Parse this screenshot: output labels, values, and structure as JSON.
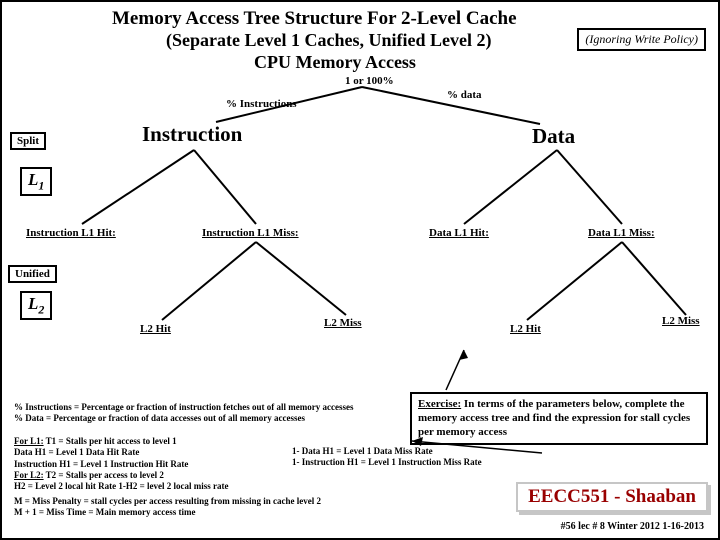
{
  "title": "Memory Access Tree Structure For 2-Level Cache",
  "subtitle": "(Separate Level 1 Caches, Unified Level 2)",
  "ignoring": "(Ignoring Write Policy)",
  "cpu": "CPU Memory  Access",
  "top_pct": "1 or 100%",
  "pct_inst": "% Instructions",
  "pct_data": "% data",
  "split": "Split",
  "inst": "Instruction",
  "data": "Data",
  "l1": "L",
  "l1_sub": "1",
  "il1_hit": "Instruction L1 Hit:",
  "il1_miss": "Instruction L1 Miss:",
  "dl1_hit": "Data L1 Hit:",
  "dl1_miss": "Data L1 Miss:",
  "unified": "Unified",
  "l2": "L",
  "l2_sub": "2",
  "l2_hit": "L2 Hit",
  "l2_miss": "L2  Miss",
  "note1a": "% Instructions = Percentage or fraction of instruction fetches out of all memory accesses",
  "note1b": "% Data = Percentage or fraction of  data accesses out of all memory accesses",
  "note2_head": "For L1:",
  "note2_t1": "    T1 =  Stalls per hit access to level 1",
  "note2_dh1": "Data H1  =  Level 1  Data Hit Rate",
  "note2_1dh1": "1- Data H1 = Level 1 Data Miss Rate",
  "note2_ih1": "Instruction H1  =   Level 1 Instruction Hit Rate",
  "note2_1ih1": "1- Instruction H1 = Level 1 Instruction Miss Rate",
  "note2_l2head": "For L2:",
  "note2_t2": "   T2 = Stalls per access to level 2",
  "note2_h2": "H2 =  Level 2 local hit Rate     1-H2 =  level 2 local miss rate",
  "note3a": "M  = Miss Penalty = stall cycles per access resulting from missing in cache level 2",
  "note3b": "M + 1 =  Miss Time = Main memory access time",
  "ex_head": "Exercise:",
  "ex_body": "  In terms of the parameters below, complete the memory access tree and find the expression for stall cycles per memory access",
  "branding": "EECC551 - Shaaban",
  "slide_no": "#56  lec # 8   Winter 2012  1-16-2013"
}
